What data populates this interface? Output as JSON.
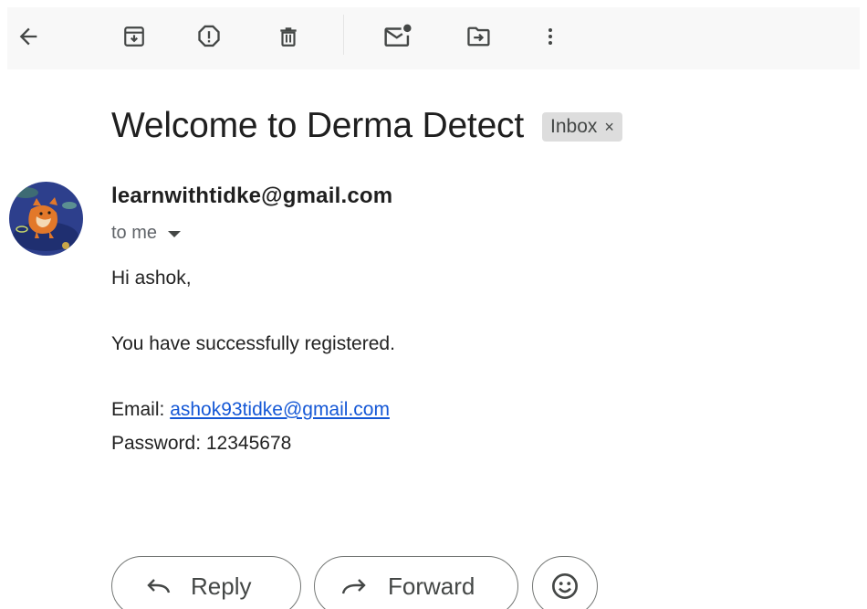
{
  "toolbar": {
    "icons": [
      "back-arrow-icon",
      "archive-icon",
      "report-spam-icon",
      "delete-icon",
      "mark-unread-icon",
      "move-to-icon",
      "more-vert-icon"
    ]
  },
  "email": {
    "subject": "Welcome to Derma Detect",
    "label": "Inbox",
    "label_remove": "×",
    "sender": "learnwithtidke@gmail.com",
    "recipient": "to me",
    "greeting": "Hi ashok,",
    "message": "You have successfully registered.",
    "email_label": "Email: ",
    "email_value": "ashok93tidke@gmail.com",
    "password_label": "Password: ",
    "password_value": "12345678"
  },
  "actions": {
    "reply": "Reply",
    "forward": "Forward",
    "emoji_icon": "emoji-smile-icon"
  },
  "colors": {
    "toolbar_bg": "#f8f8f8",
    "chip_bg": "#dddddd",
    "link": "#1558d6",
    "avatar_bg": "#2d3f8c"
  }
}
